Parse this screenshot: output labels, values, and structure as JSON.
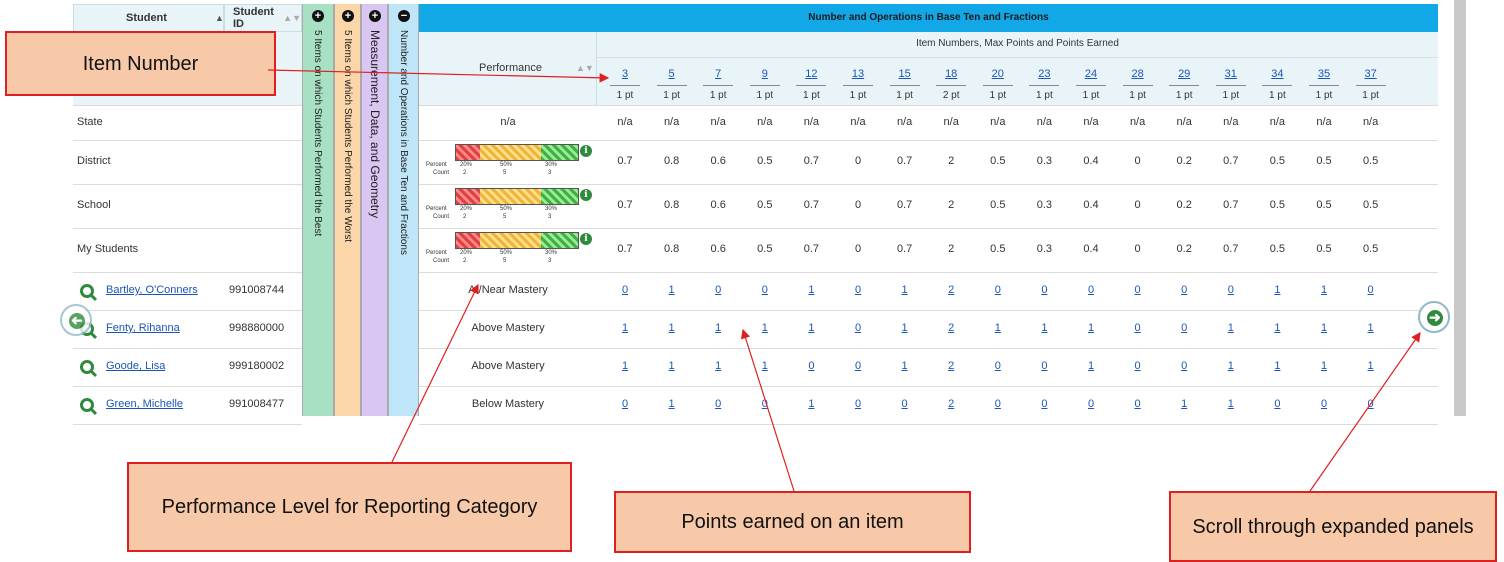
{
  "student_header": {
    "label": "Student",
    "id_label": "Student ID"
  },
  "panels": {
    "best": "5 Items on which Students Performed the Best",
    "worst": "5 Items on which Students Performed the Worst",
    "measurement": "Measurement, Data, and Geometry",
    "number_ops": "Number and Operations in Base Ten and Fractions"
  },
  "section_title": "Number and Operations in Base Ten and Fractions",
  "subheader": "Item Numbers, Max Points and Points Earned",
  "performance_label": "Performance",
  "items": [
    {
      "num": "3",
      "pts": "1 pt"
    },
    {
      "num": "5",
      "pts": "1 pt"
    },
    {
      "num": "7",
      "pts": "1 pt"
    },
    {
      "num": "9",
      "pts": "1 pt"
    },
    {
      "num": "12",
      "pts": "1 pt"
    },
    {
      "num": "13",
      "pts": "1 pt"
    },
    {
      "num": "15",
      "pts": "1 pt"
    },
    {
      "num": "18",
      "pts": "2 pt"
    },
    {
      "num": "20",
      "pts": "1 pt"
    },
    {
      "num": "23",
      "pts": "1 pt"
    },
    {
      "num": "24",
      "pts": "1 pt"
    },
    {
      "num": "28",
      "pts": "1 pt"
    },
    {
      "num": "29",
      "pts": "1 pt"
    },
    {
      "num": "31",
      "pts": "1 pt"
    },
    {
      "num": "34",
      "pts": "1 pt"
    },
    {
      "num": "35",
      "pts": "1 pt"
    },
    {
      "num": "37",
      "pts": "1 pt"
    }
  ],
  "summary_rows": [
    {
      "label": "State",
      "performance": "n/a",
      "values": [
        "n/a",
        "n/a",
        "n/a",
        "n/a",
        "n/a",
        "n/a",
        "n/a",
        "n/a",
        "n/a",
        "n/a",
        "n/a",
        "n/a",
        "n/a",
        "n/a",
        "n/a",
        "n/a",
        "n/a"
      ]
    },
    {
      "label": "District",
      "values": [
        "0.7",
        "0.8",
        "0.6",
        "0.5",
        "0.7",
        "0",
        "0.7",
        "2",
        "0.5",
        "0.3",
        "0.4",
        "0",
        "0.2",
        "0.7",
        "0.5",
        "0.5",
        "0.5"
      ]
    },
    {
      "label": "School",
      "values": [
        "0.7",
        "0.8",
        "0.6",
        "0.5",
        "0.7",
        "0",
        "0.7",
        "2",
        "0.5",
        "0.3",
        "0.4",
        "0",
        "0.2",
        "0.7",
        "0.5",
        "0.5",
        "0.5"
      ]
    },
    {
      "label": "My Students",
      "values": [
        "0.7",
        "0.8",
        "0.6",
        "0.5",
        "0.7",
        "0",
        "0.7",
        "2",
        "0.5",
        "0.3",
        "0.4",
        "0",
        "0.2",
        "0.7",
        "0.5",
        "0.5",
        "0.5"
      ]
    }
  ],
  "bar_legend": {
    "percent_label": "Percent",
    "count_label": "Count",
    "percents": [
      "20%",
      "50%",
      "30%"
    ],
    "counts": [
      "2",
      "5",
      "3"
    ]
  },
  "students": [
    {
      "name": "Bartley, O'Conners",
      "id": "991008744",
      "performance": "At/Near Mastery",
      "values": [
        "0",
        "1",
        "0",
        "0",
        "1",
        "0",
        "1",
        "2",
        "0",
        "0",
        "0",
        "0",
        "0",
        "0",
        "1",
        "1",
        "0"
      ]
    },
    {
      "name": "Fenty, Rihanna",
      "id": "998880000",
      "performance": "Above Mastery",
      "values": [
        "1",
        "1",
        "1",
        "1",
        "1",
        "0",
        "1",
        "2",
        "1",
        "1",
        "1",
        "0",
        "0",
        "1",
        "1",
        "1",
        "1"
      ]
    },
    {
      "name": "Goode, Lisa",
      "id": "999180002",
      "performance": "Above Mastery",
      "values": [
        "1",
        "1",
        "1",
        "1",
        "0",
        "0",
        "1",
        "2",
        "0",
        "0",
        "1",
        "0",
        "0",
        "1",
        "1",
        "1",
        "1"
      ]
    },
    {
      "name": "Green, Michelle",
      "id": "991008477",
      "performance": "Below Mastery",
      "values": [
        "0",
        "1",
        "0",
        "0",
        "1",
        "0",
        "0",
        "2",
        "0",
        "0",
        "0",
        "0",
        "1",
        "1",
        "0",
        "0",
        "0"
      ]
    }
  ],
  "callouts": {
    "item_number": "Item Number",
    "performance_level": "Performance Level for Reporting Category",
    "points_earned": "Points earned on an item",
    "scroll": "Scroll through expanded panels"
  },
  "icons": [
    "search-icon",
    "info-icon",
    "plus-circle-icon",
    "minus-circle-icon",
    "sort-icon",
    "arrow-right-icon"
  ],
  "colors": {
    "header_blue": "#12a8e8",
    "callout_fill": "#f8c9a8",
    "callout_border": "#e02020",
    "link": "#1a56b8",
    "green": "#2e8b3d"
  }
}
